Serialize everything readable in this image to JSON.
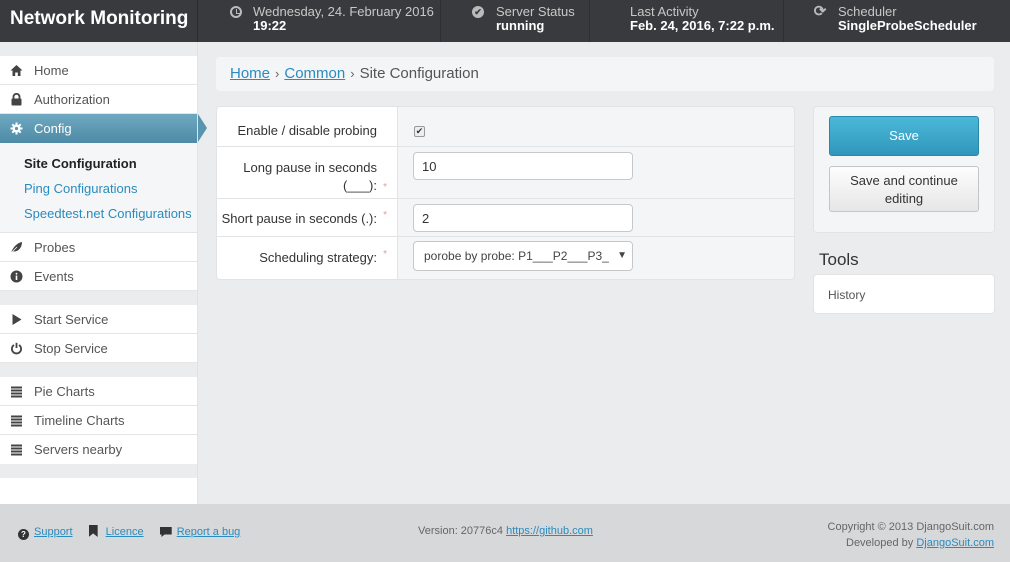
{
  "header": {
    "brand": "Network Monitoring",
    "date_label": "Wednesday, 24. February 2016",
    "time": "19:22",
    "server_status_label": "Server Status",
    "server_status_value": "running",
    "last_activity_label": "Last Activity",
    "last_activity_value": "Feb. 24, 2016, 7:22 p.m.",
    "scheduler_label": "Scheduler",
    "scheduler_value": "SingleProbeScheduler"
  },
  "sidebar": {
    "items": [
      {
        "label": "Home",
        "icon": "home-icon"
      },
      {
        "label": "Authorization",
        "icon": "lock-icon"
      },
      {
        "label": "Config",
        "icon": "gear-icon",
        "active": true
      },
      {
        "label": "Probes",
        "icon": "leaf-icon"
      },
      {
        "label": "Events",
        "icon": "info-icon"
      },
      {
        "label": "Start Service",
        "icon": "play-icon"
      },
      {
        "label": "Stop Service",
        "icon": "power-icon"
      },
      {
        "label": "Pie Charts",
        "icon": "list-icon"
      },
      {
        "label": "Timeline Charts",
        "icon": "list-icon"
      },
      {
        "label": "Servers nearby",
        "icon": "list-icon"
      }
    ],
    "subitems": [
      {
        "label": "Site Configuration",
        "current": true
      },
      {
        "label": "Ping Configurations"
      },
      {
        "label": "Speedtest.net Configurations"
      }
    ]
  },
  "breadcrumb": {
    "home": "Home",
    "common": "Common",
    "current": "Site Configuration",
    "separator": "›"
  },
  "form": {
    "enable_label": "Enable / disable probing",
    "enable_checked": true,
    "long_pause_label_line1": "Long pause in seconds",
    "long_pause_label_line2": "(___):",
    "long_pause_value": "10",
    "short_pause_label": "Short pause in seconds (.):",
    "short_pause_value": "2",
    "strategy_label": "Scheduling strategy:",
    "strategy_value": "porobe by probe: P1___P2___P3_",
    "required_marker": "*"
  },
  "actions": {
    "save": "Save",
    "save_continue": "Save and continue editing",
    "tools_title": "Tools",
    "history": "History"
  },
  "footer": {
    "support": "Support",
    "licence": "Licence",
    "report_bug": "Report a bug",
    "version_label": "Version: 20776c4",
    "version_link": "https://github.com",
    "copyright": "Copyright © 2013 DjangoSuit.com",
    "developed_by": "Developed by",
    "developer_link": "DjangoSuit.com"
  },
  "colors": {
    "header_bg": "#393a3d",
    "accent": "#2f97bc",
    "active_nav": "#5a95b0",
    "link": "#2a8bbf"
  }
}
